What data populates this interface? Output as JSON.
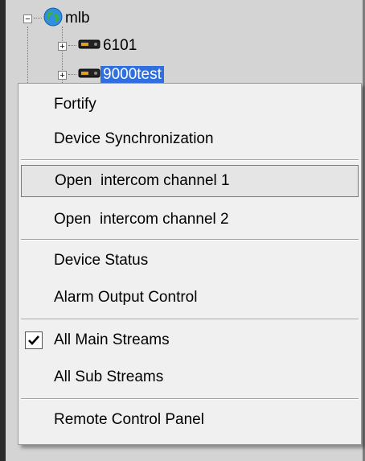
{
  "tree": {
    "root": {
      "expander": "−",
      "icon": "globe-icon",
      "label": "mlb"
    },
    "children": [
      {
        "expander": "+",
        "icon": "device-icon",
        "label": "6101",
        "selected": false
      },
      {
        "expander": "+",
        "icon": "device-icon",
        "label": "9000test",
        "selected": true
      }
    ]
  },
  "menu": {
    "items": [
      {
        "label": "Fortify"
      },
      {
        "label": "Device Synchronization"
      },
      {
        "label": "Open  intercom channel 1",
        "highlighted": true
      },
      {
        "label": "Open  intercom channel 2"
      },
      {
        "label": "Device Status"
      },
      {
        "label": "Alarm Output Control"
      },
      {
        "label": "All Main Streams",
        "checked": true
      },
      {
        "label": "All Sub Streams"
      },
      {
        "label": "Remote Control Panel"
      }
    ]
  },
  "colors": {
    "selection": "#2f6fe0",
    "menu_bg": "#f0f0f0",
    "frame_bg": "#d4d4d4"
  }
}
